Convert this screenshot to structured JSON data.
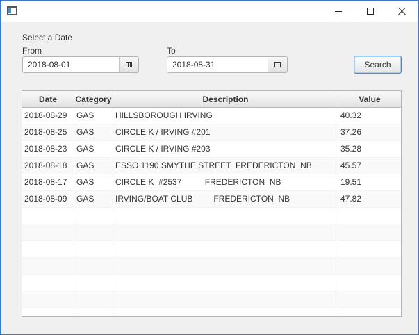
{
  "window": {
    "minimize_icon": "minimize-icon",
    "maximize_icon": "maximize-icon",
    "close_icon": "close-icon"
  },
  "form": {
    "select_label": "Select a Date",
    "from_label": "From",
    "to_label": "To",
    "from_value": "2018-08-01",
    "to_value": "2018-08-31",
    "calendar_icon": "calendar-icon",
    "search_label": "Search"
  },
  "table": {
    "columns": [
      "Date",
      "Category",
      "Description",
      "Value"
    ],
    "rows": [
      {
        "date": "2018-08-29",
        "category": "GAS",
        "description": "HILLSBOROUGH IRVING",
        "value": "40.32"
      },
      {
        "date": "2018-08-25",
        "category": "GAS",
        "description": "CIRCLE K / IRVING #201",
        "value": "37.26"
      },
      {
        "date": "2018-08-23",
        "category": "GAS",
        "description": "CIRCLE K / IRVING #203",
        "value": "35.28"
      },
      {
        "date": "2018-08-18",
        "category": "GAS",
        "description": "ESSO 1190 SMYTHE STREET  FREDERICTON  NB",
        "value": "45.57"
      },
      {
        "date": "2018-08-17",
        "category": "GAS",
        "description": "CIRCLE K  #2537          FREDERICTON  NB",
        "value": "19.51"
      },
      {
        "date": "2018-08-09",
        "category": "GAS",
        "description": "IRVING/BOAT CLUB         FREDERICTON  NB",
        "value": "47.82"
      }
    ],
    "empty_rows": 7
  },
  "colors": {
    "accent": "#3d8fd1",
    "window_border": "#3c78c8"
  }
}
